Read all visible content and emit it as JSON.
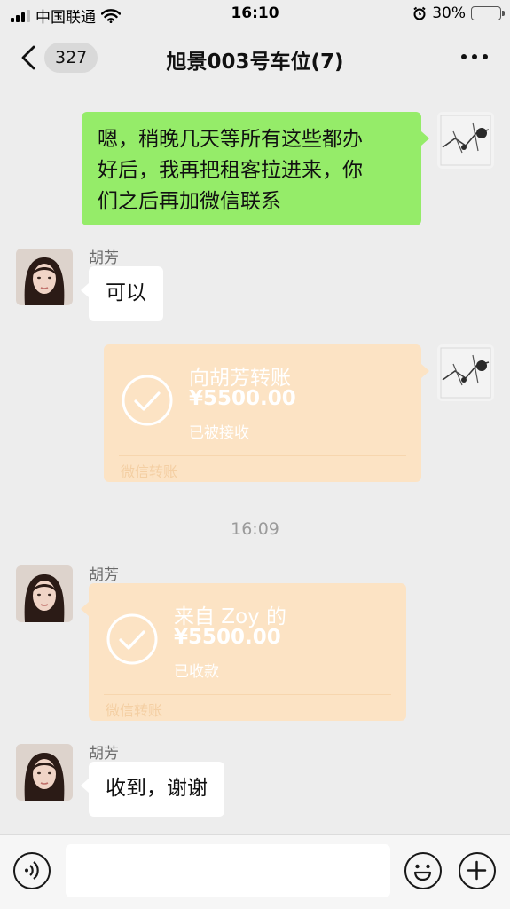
{
  "status_bar": {
    "carrier": "中国联通",
    "time": "16:10",
    "battery": "30%",
    "battery_level": 0.3
  },
  "nav": {
    "back_icon": "chevron-left-icon",
    "unread_count": "327",
    "title": "旭景003号车位(7)",
    "more_icon": "more-dots-icon"
  },
  "messages": [
    {
      "type": "text",
      "side": "right",
      "text_lines": [
        "嗯，稍晚几天等所有这些都办",
        "好后，我再把租客拉进来，你",
        "们之后再加微信联系"
      ]
    },
    {
      "type": "text",
      "side": "left",
      "sender": "胡芳",
      "text": "可以"
    },
    {
      "type": "transfer",
      "side": "right",
      "title": "向胡芳转账",
      "amount": "¥5500.00",
      "status": "已被接收",
      "footer": "微信转账"
    },
    {
      "type": "time",
      "text": "16:09"
    },
    {
      "type": "transfer",
      "side": "left",
      "sender": "胡芳",
      "title": "来自 Zoy 的",
      "amount": "¥5500.00",
      "status": "已收款",
      "footer": "微信转账"
    },
    {
      "type": "text",
      "side": "left",
      "sender": "胡芳",
      "text": "收到，谢谢"
    }
  ],
  "input_bar": {
    "voice_icon": "voice-icon",
    "emoji_icon": "emoji-icon",
    "plus_icon": "plus-icon",
    "input_value": ""
  },
  "colors": {
    "background": "#ededed",
    "my_bubble": "#95ec69",
    "their_bubble": "#ffffff",
    "transfer_card": "#fce3c4"
  }
}
